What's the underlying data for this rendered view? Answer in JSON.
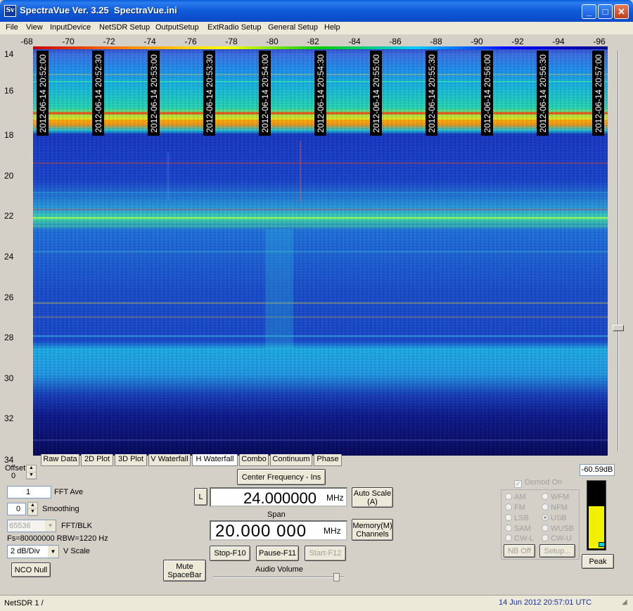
{
  "window": {
    "title": "SpectraVue Ver. 3.25  SpectraVue.ini",
    "icon_text": "Sv",
    "minimize_glyph": "_",
    "maximize_glyph": "□",
    "close_glyph": "✕"
  },
  "menu": [
    "File",
    "View",
    "InputDevice",
    "NetSDR Setup",
    "OutputSetup",
    "ExtRadio Setup",
    "General Setup",
    "Help"
  ],
  "x_axis_ticks": [
    "-68",
    "-70",
    "-72",
    "-74",
    "-76",
    "-78",
    "-80",
    "-82",
    "-84",
    "-86",
    "-88",
    "-90",
    "-92",
    "-94",
    "-96"
  ],
  "y_axis_ticks": [
    "14",
    "16",
    "18",
    "20",
    "22",
    "24",
    "26",
    "28",
    "30",
    "32",
    "34"
  ],
  "timestamps": [
    "2012-06-14 20:52:00",
    "2012-06-14 20:52:30",
    "2012-06-14 20:53:00",
    "2012-06-14 20:53:30",
    "2012-06-14 20:54:00",
    "2012-06-14 20:54:30",
    "2012-06-14 20:55:00",
    "2012-06-14 20:55:30",
    "2012-06-14 20:56:00",
    "2012-06-14 20:56:30",
    "2012-06-14 20:57:00"
  ],
  "tabs": [
    "Raw Data",
    "2D Plot",
    "3D Plot",
    "V Waterfall",
    "H Waterfall",
    "Combo",
    "Continuum",
    "Phase"
  ],
  "active_tab": "H Waterfall",
  "controls": {
    "offset_label": "Offset",
    "offset_value": "0",
    "fft_ave_value": "1",
    "fft_ave_label": "FFT Ave",
    "smoothing_value": "0",
    "smoothing_label": "Smoothing",
    "fft_blk_value": "65536",
    "fft_blk_label": "FFT/BLK",
    "fs_info": "Fs=80000000 RBW=1220 Hz",
    "vscale_value": "2 dB/Div",
    "vscale_label": "V Scale",
    "nco_null": "NCO Null",
    "mute": "Mute\nSpaceBar",
    "center_freq_button": "Center Frequency - Ins",
    "l_button": "L",
    "center_freq_value": "24.000000",
    "freq_unit": "MHz",
    "span_label": "Span",
    "span_value": "20.000 000",
    "span_unit": "MHz",
    "auto_scale": "Auto Scale\n(A)",
    "memory": "Memory(M)\nChannels",
    "stop": "Stop-F10",
    "pause": "Pause-F11",
    "start": "Start-F12",
    "audio_volume": "Audio Volume",
    "level": "-60.59dB",
    "demod_on": "Demod On",
    "nb_off": "NB Off",
    "setup": "Setup...",
    "peak": "Peak",
    "meter_level": 0.62
  },
  "demod_modes": [
    {
      "label": "AM",
      "selected": false
    },
    {
      "label": "WFM",
      "selected": false
    },
    {
      "label": "FM",
      "selected": false
    },
    {
      "label": "NFM",
      "selected": false
    },
    {
      "label": "LSB",
      "selected": false
    },
    {
      "label": "USB",
      "selected": true
    },
    {
      "label": "SAM",
      "selected": false
    },
    {
      "label": "WUSB",
      "selected": false
    },
    {
      "label": "CW-L",
      "selected": false
    },
    {
      "label": "CW-U",
      "selected": false
    }
  ],
  "status": {
    "device": "NetSDR 1  /",
    "datetime": "14 Jun 2012  20:57:01 UTC"
  },
  "colors": {
    "waterfall_background": "#1a2fb0",
    "meter_fill": "#f0f000",
    "status_datetime": "#1a2fa0"
  }
}
